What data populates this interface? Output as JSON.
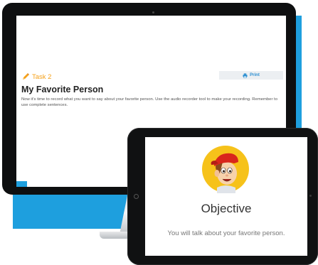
{
  "task": {
    "label": "Task 2",
    "title": "My Favorite Person",
    "instructions": "Now it's time to record what you want to say about your favorite person. Use the audio recorder tool to make your recording. Remember to use complete sentences.",
    "print_label": "Print"
  },
  "tablet": {
    "objective_title": "Objective",
    "objective_text": "You will talk about your favorite person."
  },
  "icons": {
    "task": "pencil-icon",
    "print": "printer-icon",
    "avatar": "boy-with-red-cap-avatar"
  },
  "colors": {
    "accent_blue": "#1e9fde",
    "task_orange": "#f5a11a",
    "print_blue": "#2a8ed1",
    "avatar_yellow": "#f6c21a",
    "cap_red": "#d9261c"
  }
}
